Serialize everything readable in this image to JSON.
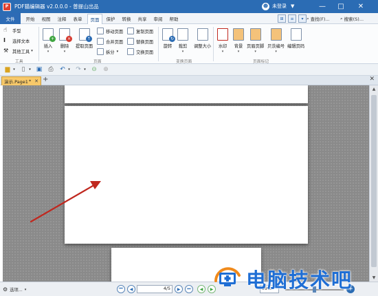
{
  "window": {
    "title": "PDF猫编辑器 v2.0.0.0 - 普提山出品",
    "app_icon_text": "P",
    "user_label": "未登录",
    "minimize": "—",
    "maximize": "□",
    "close": "✕"
  },
  "menu": {
    "file": "文件",
    "tabs": [
      "开始",
      "视图",
      "注释",
      "表单",
      "页面",
      "保护",
      "转换",
      "共享",
      "审阅",
      "帮助"
    ],
    "active_tab": "页面",
    "find_label": "查找(F)...",
    "search_label": "搜索(S)..."
  },
  "ribbon": {
    "tools": {
      "hand": "手型",
      "select_text": "选择文本",
      "other_tools": "其他工具",
      "group": "工具"
    },
    "page": {
      "insert": "插入",
      "delete": "删除",
      "extract": "提取页面",
      "move": "移动页面",
      "merge": "合并页面",
      "split": "拆分",
      "copy": "复制页面",
      "replace": "替换页面",
      "swap": "交换页面",
      "group": "页面"
    },
    "transform": {
      "rotate": "旋转",
      "crop": "裁剪",
      "resize": "调整大小",
      "group": "变换页面"
    },
    "marks": {
      "watermark": "水印",
      "background": "背景",
      "header_footer": "页眉页脚",
      "bates": "贝茨编号",
      "edit_page_num": "编辑页码",
      "group": "页面标记"
    }
  },
  "document": {
    "tab_label": "演示.Page1",
    "tab_mark": "*"
  },
  "statusbar": {
    "options": "选项...",
    "page_value": "4/5",
    "zoom_value": "59%"
  },
  "watermark": {
    "text": "电脑技术吧"
  },
  "colors": {
    "titlebar": "#2b6cb4",
    "accent_red": "#c0281f",
    "watermark_blue": "#1f6ed4"
  }
}
